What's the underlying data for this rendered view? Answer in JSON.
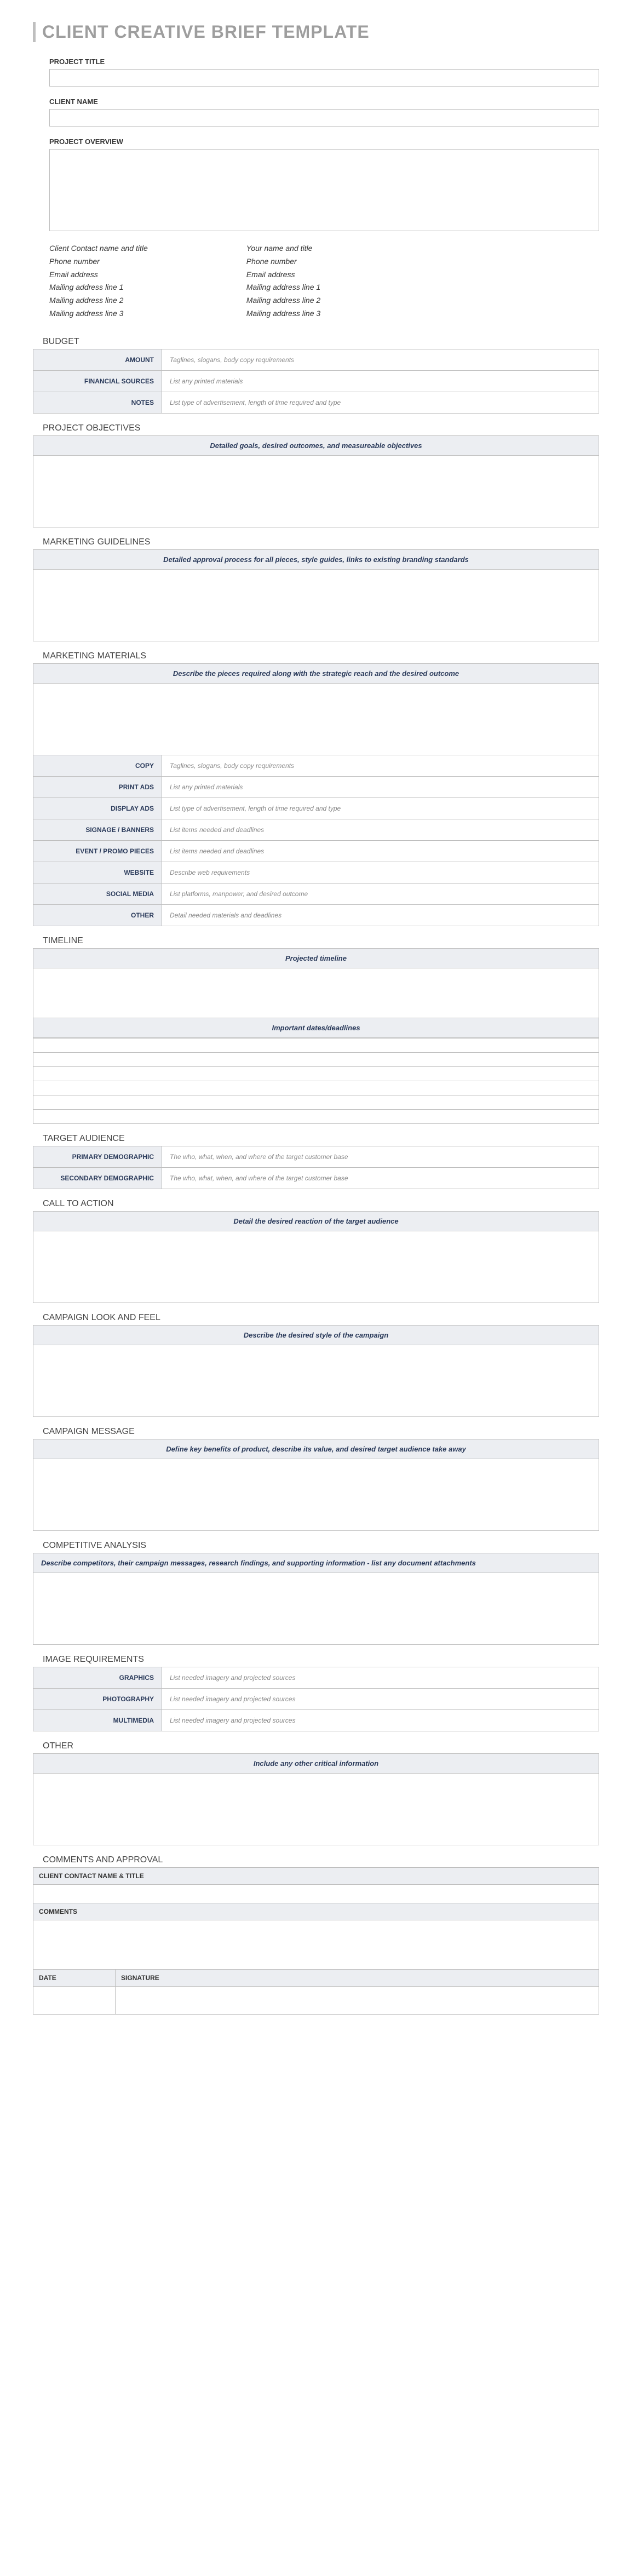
{
  "doc_title": "CLIENT CREATIVE BRIEF TEMPLATE",
  "fields": {
    "project_title": "PROJECT TITLE",
    "client_name": "CLIENT NAME",
    "project_overview": "PROJECT OVERVIEW"
  },
  "contacts": {
    "client": [
      "Client Contact name and title",
      "Phone number",
      "Email address",
      "Mailing address line 1",
      "Mailing address line 2",
      "Mailing address line 3"
    ],
    "self": [
      "Your name and title",
      "Phone number",
      "Email address",
      "Mailing address line 1",
      "Mailing address line 2",
      "Mailing address line 3"
    ]
  },
  "budget": {
    "title": "BUDGET",
    "rows": [
      {
        "label": "AMOUNT",
        "hint": "Taglines, slogans, body copy requirements"
      },
      {
        "label": "FINANCIAL SOURCES",
        "hint": "List any printed materials"
      },
      {
        "label": "NOTES",
        "hint": "List type of advertisement, length of time required and type"
      }
    ]
  },
  "project_objectives": {
    "title": "PROJECT OBJECTIVES",
    "header": "Detailed goals, desired outcomes, and measureable objectives"
  },
  "marketing_guidelines": {
    "title": "MARKETING GUIDELINES",
    "header": "Detailed approval process for all pieces, style guides, links to existing branding standards"
  },
  "marketing_materials": {
    "title": "MARKETING MATERIALS",
    "header": "Describe the pieces required along with the strategic reach and the desired outcome",
    "rows": [
      {
        "label": "COPY",
        "hint": "Taglines, slogans, body copy requirements"
      },
      {
        "label": "PRINT ADS",
        "hint": "List any printed materials"
      },
      {
        "label": "DISPLAY ADS",
        "hint": "List type of advertisement, length of time required and type"
      },
      {
        "label": "SIGNAGE / BANNERS",
        "hint": "List items needed and deadlines"
      },
      {
        "label": "EVENT / PROMO PIECES",
        "hint": "List items needed and deadlines"
      },
      {
        "label": "WEBSITE",
        "hint": "Describe web requirements"
      },
      {
        "label": "SOCIAL MEDIA",
        "hint": "List platforms, manpower, and desired outcome"
      },
      {
        "label": "OTHER",
        "hint": "Detail needed materials and deadlines"
      }
    ]
  },
  "timeline": {
    "title": "TIMELINE",
    "projected": "Projected timeline",
    "important": "Important dates/deadlines"
  },
  "target_audience": {
    "title": "TARGET AUDIENCE",
    "rows": [
      {
        "label": "PRIMARY DEMOGRAPHIC",
        "hint": "The who, what, when, and where of the target customer base"
      },
      {
        "label": "SECONDARY DEMOGRAPHIC",
        "hint": "The who, what, when, and where of the target customer base"
      }
    ]
  },
  "call_to_action": {
    "title": "CALL TO ACTION",
    "header": "Detail the desired reaction of the target audience"
  },
  "campaign_look": {
    "title": "CAMPAIGN LOOK AND FEEL",
    "header": "Describe the desired style of the campaign"
  },
  "campaign_message": {
    "title": "CAMPAIGN MESSAGE",
    "header": "Define key benefits of product, describe its value, and desired target audience take away"
  },
  "competitive": {
    "title": "COMPETITIVE ANALYSIS",
    "header": "Describe competitors, their campaign messages, research findings, and supporting information - list any document attachments"
  },
  "image_req": {
    "title": "IMAGE REQUIREMENTS",
    "rows": [
      {
        "label": "GRAPHICS",
        "hint": "List needed imagery and projected sources"
      },
      {
        "label": "PHOTOGRAPHY",
        "hint": "List needed imagery and projected sources"
      },
      {
        "label": "MULTIMEDIA",
        "hint": "List needed imagery and projected sources"
      }
    ]
  },
  "other": {
    "title": "OTHER",
    "header": "Include any other critical information"
  },
  "approval": {
    "title": "COMMENTS AND APPROVAL",
    "contact": "CLIENT CONTACT NAME & TITLE",
    "comments": "COMMENTS",
    "date": "DATE",
    "signature": "SIGNATURE"
  }
}
